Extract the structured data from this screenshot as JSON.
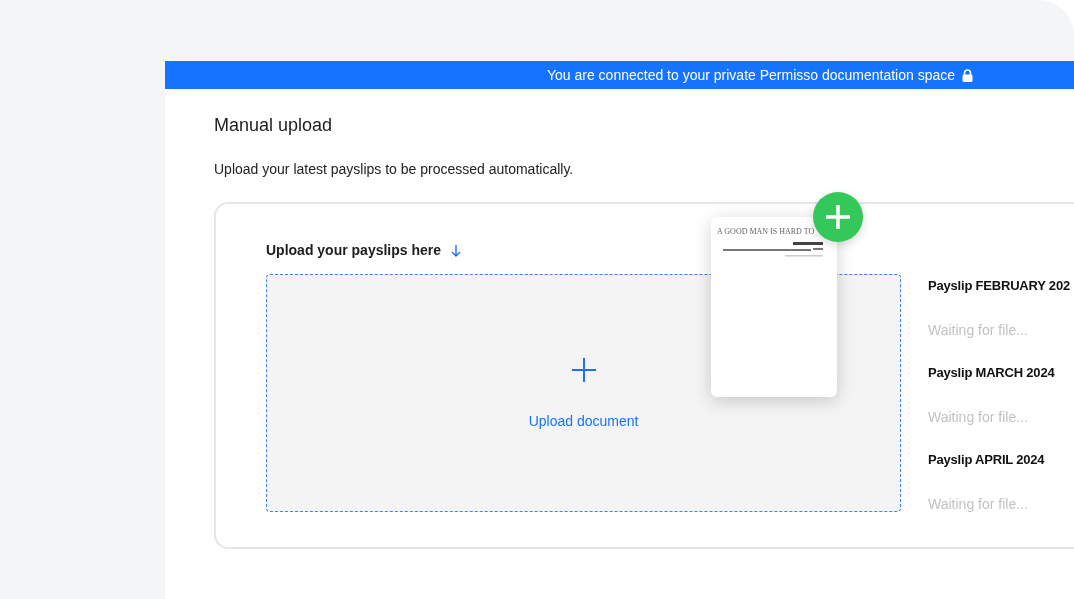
{
  "banner": {
    "text": "You are connected to your private Permisso documentation space"
  },
  "page": {
    "title": "Manual upload",
    "subtitle": "Upload your latest payslips to be processed automatically."
  },
  "upload": {
    "label": "Upload your payslips here",
    "button": "Upload document",
    "dragged_document": {
      "title": "A GOOD MAN IS HARD TO"
    }
  },
  "payslips": [
    {
      "name": "Payslip FEBRUARY 202",
      "status": "Waiting for file..."
    },
    {
      "name": "Payslip MARCH 2024",
      "status": "Waiting for file..."
    },
    {
      "name": "Payslip APRIL 2024",
      "status": "Waiting for file..."
    }
  ]
}
